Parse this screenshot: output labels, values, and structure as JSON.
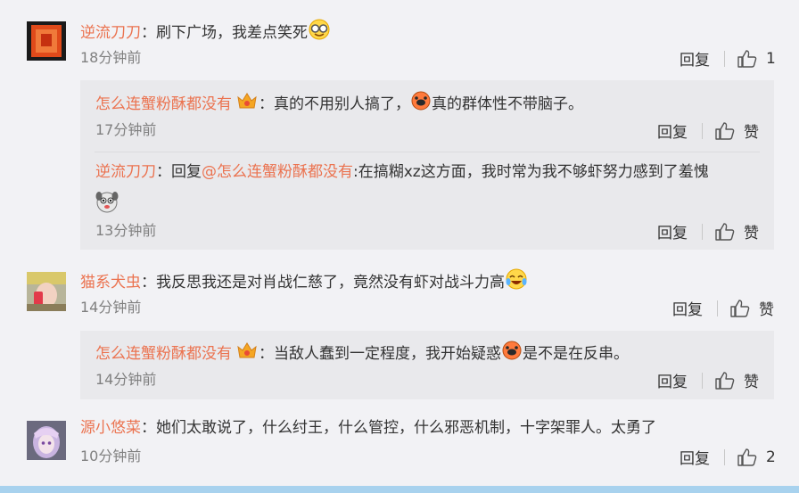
{
  "comments": [
    {
      "user": "逆流刀刀",
      "text": "刷下广场，我差点笑死",
      "time": "18分钟前",
      "reply_label": "回复",
      "like_count": "1",
      "replies": [
        {
          "user": "怎么连蟹粉酥都没有",
          "text_before": "真的不用别人搞了，",
          "text_after": "真的群体性不带脑子。",
          "time": "17分钟前",
          "reply_label": "回复",
          "like_label": "赞"
        },
        {
          "user": "逆流刀刀",
          "reply_prefix": "回复",
          "mention": "@怎么连蟹粉酥都没有",
          "text": ":在搞糊xz这方面，我时常为我不够虾努力感到了羞愧",
          "time": "13分钟前",
          "reply_label": "回复",
          "like_label": "赞"
        }
      ]
    },
    {
      "user": "猫系犬虫",
      "text": "我反思我还是对肖战仁慈了，竟然没有虾对战斗力高",
      "time": "14分钟前",
      "reply_label": "回复",
      "like_label": "赞",
      "replies": [
        {
          "user": "怎么连蟹粉酥都没有",
          "text_before": "当敌人蠢到一定程度，我开始疑惑",
          "text_after": "是不是在反串。",
          "time": "14分钟前",
          "reply_label": "回复",
          "like_label": "赞"
        }
      ]
    },
    {
      "user": "源小悠菜",
      "text": "她们太敢说了，什么纣王，什么管控，什么邪恶机制，十字架罪人。太勇了",
      "time": "10分钟前",
      "reply_label": "回复",
      "like_count": "2"
    }
  ],
  "colors": {
    "username": "#eb7350",
    "background": "#f2f2f5",
    "reply_box": "#e9e9ec",
    "time": "#808080"
  },
  "icons": [
    "thumbs-up-icon",
    "laugh-glasses-emoji",
    "crown-badge-icon",
    "pig-face-emoji",
    "dog-emoji",
    "laugh-tears-emoji"
  ]
}
